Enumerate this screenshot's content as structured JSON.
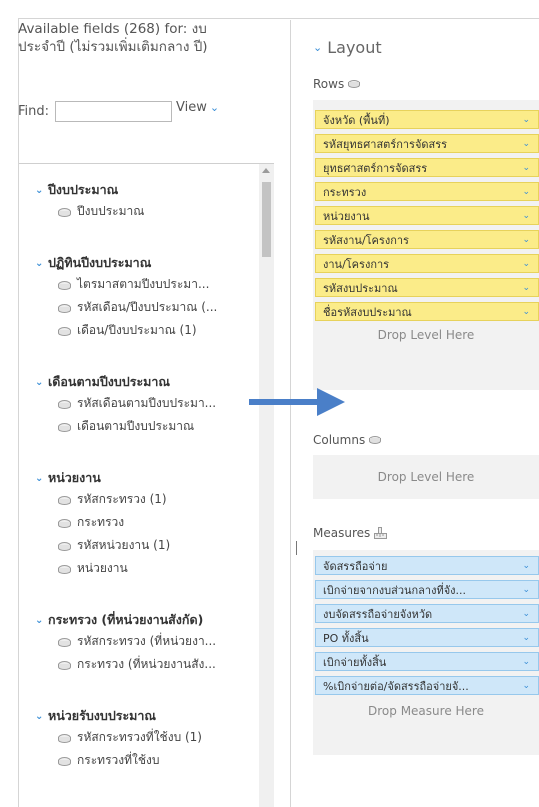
{
  "left": {
    "title": "Available fields (268) for: งบประจำปี (ไม่รวมเพิ่มเติมกลาง ปี)",
    "find_label": "Find:",
    "find_value": "",
    "view_label": "View"
  },
  "tree": [
    {
      "label": "ปีงบประมาณ",
      "fields": [
        "ปีงบประมาณ"
      ]
    },
    {
      "label": "ปฏิทินปีงบประมาณ",
      "fields": [
        "ไตรมาสตามปีงบประมา...",
        "รหัสเดือน/ปีงบประมาณ (...",
        "เดือน/ปีงบประมาณ (1)"
      ]
    },
    {
      "label": "เดือนตามปีงบประมาณ",
      "fields": [
        "รหัสเดือนตามปีงบประมา...",
        "เดือนตามปีงบประมาณ"
      ]
    },
    {
      "label": "หน่วยงาน",
      "fields": [
        "รหัสกระทรวง (1)",
        "กระทรวง",
        "รหัสหน่วยงาน (1)",
        "หน่วยงาน"
      ]
    },
    {
      "label": "กระทรวง (ที่หน่วยงานสังกัด)",
      "fields": [
        "รหัสกระทรวง (ที่หน่วยงา...",
        "กระทรวง (ที่หน่วยงานสัง..."
      ]
    },
    {
      "label": "หน่วยรับงบประมาณ",
      "fields": [
        "รหัสกระทรวงที่ใช้งบ (1)",
        "กระทรวงที่ใช้งบ"
      ]
    }
  ],
  "layout": {
    "title": "Layout",
    "rows_label": "Rows",
    "rows": [
      "จังหวัด (พื้นที่)",
      "รหัสยุทธศาสตร์การจัดสรร",
      "ยุทธศาสตร์การจัดสรร",
      "กระทรวง",
      "หน่วยงาน",
      "รหัสงาน/โครงการ",
      "งาน/โครงการ",
      "รหัสงบประมาณ",
      "ชื่อรหัสงบประมาณ"
    ],
    "rows_drop": "Drop Level Here",
    "columns_label": "Columns",
    "columns_drop": "Drop Level Here",
    "measures_label": "Measures",
    "measures": [
      "จัดสรรถือจ่าย",
      "เบิกจ่ายจากงบส่วนกลางที่จัง...",
      "งบจัดสรรถือจ่ายจังหวัด",
      "PO ทั้งสิ้น",
      "เบิกจ่ายทั้งสิ้น",
      "%เบิกจ่ายต่อ/จัดสรรถือจ่ายจั..."
    ],
    "measures_drop": "Drop Measure Here"
  },
  "colors": {
    "row_pill_bg": "#fbec89",
    "measure_pill_bg": "#cfe7f9",
    "accent": "#3a8ed6",
    "arrow": "#4a7fc8"
  }
}
